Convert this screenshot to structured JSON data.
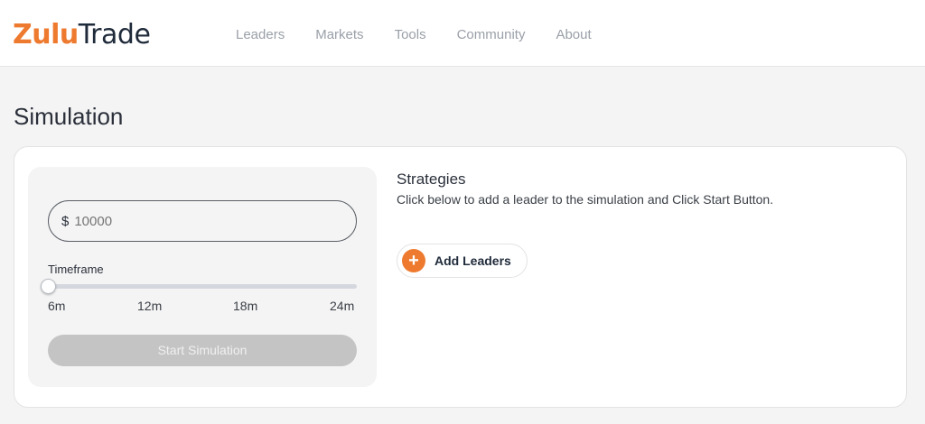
{
  "brand": {
    "name_part1": "Zulu",
    "name_part2": "Trade",
    "accent": "#ee7a2f"
  },
  "nav": {
    "items": [
      {
        "label": "Leaders"
      },
      {
        "label": "Markets"
      },
      {
        "label": "Tools"
      },
      {
        "label": "Community"
      },
      {
        "label": "About"
      }
    ]
  },
  "page": {
    "title": "Simulation"
  },
  "simulation": {
    "currency": "$",
    "amount_placeholder": "10000",
    "timeframe_label": "Timeframe",
    "timeframe_ticks": [
      "6m",
      "12m",
      "18m",
      "24m"
    ],
    "timeframe_selected": "6m",
    "start_label": "Start Simulation",
    "start_disabled": true
  },
  "strategies": {
    "title": "Strategies",
    "description": "Click below to add a leader to the simulation and Click Start Button.",
    "add_label": "Add Leaders",
    "add_icon": "plus-icon"
  }
}
